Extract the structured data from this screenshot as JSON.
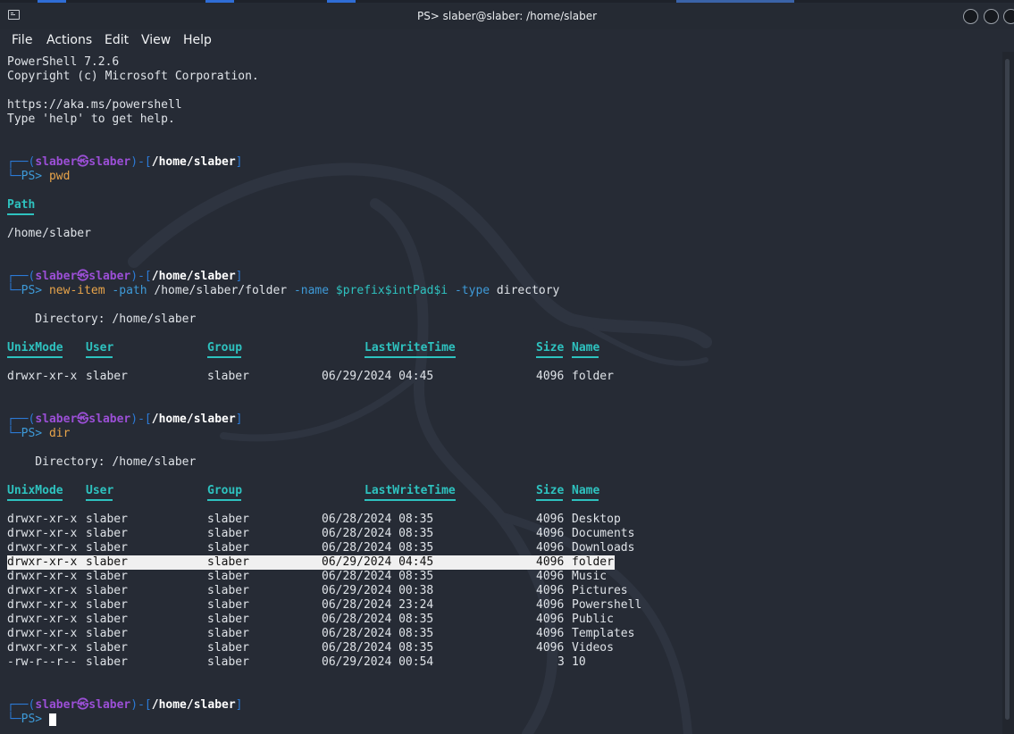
{
  "window": {
    "title": "PS> slaber@slaber: /home/slaber"
  },
  "menu": [
    "File",
    "Actions",
    "Edit",
    "View",
    "Help"
  ],
  "banner": [
    "PowerShell 7.2.6",
    "Copyright (c) Microsoft Corporation.",
    "",
    "https://aka.ms/powershell",
    "Type 'help' to get help."
  ],
  "prompt": {
    "user": "slaber",
    "symbol": "㉿",
    "host": "slaber",
    "dir": "/home/slaber",
    "ps": "PS>"
  },
  "cmd1": {
    "text": "pwd",
    "path_header": "Path",
    "path_value": "/home/slaber"
  },
  "cmd2": {
    "parts": [
      {
        "t": "new-item",
        "c": "cmd"
      },
      {
        "t": " ",
        "c": ""
      },
      {
        "t": "-path",
        "c": "prm"
      },
      {
        "t": " /home/slaber/folder ",
        "c": ""
      },
      {
        "t": "-name",
        "c": "prm"
      },
      {
        "t": " ",
        "c": ""
      },
      {
        "t": "$prefix$intPad$i",
        "c": "grnn"
      },
      {
        "t": " ",
        "c": ""
      },
      {
        "t": "-type",
        "c": "prm"
      },
      {
        "t": " directory",
        "c": ""
      }
    ],
    "directory_label": "    Directory: /home/slaber",
    "rows": [
      [
        "drwxr-xr-x",
        "slaber",
        "slaber",
        "06/29/2024 04:45",
        "4096",
        "folder"
      ]
    ]
  },
  "cmd3": {
    "text": "dir",
    "directory_label": "    Directory: /home/slaber",
    "selected_row": 3,
    "rows": [
      [
        "drwxr-xr-x",
        "slaber",
        "slaber",
        "06/28/2024 08:35",
        "4096",
        "Desktop"
      ],
      [
        "drwxr-xr-x",
        "slaber",
        "slaber",
        "06/28/2024 08:35",
        "4096",
        "Documents"
      ],
      [
        "drwxr-xr-x",
        "slaber",
        "slaber",
        "06/28/2024 08:35",
        "4096",
        "Downloads"
      ],
      [
        "drwxr-xr-x",
        "slaber",
        "slaber",
        "06/29/2024 04:45",
        "4096",
        "folder"
      ],
      [
        "drwxr-xr-x",
        "slaber",
        "slaber",
        "06/28/2024 08:35",
        "4096",
        "Music"
      ],
      [
        "drwxr-xr-x",
        "slaber",
        "slaber",
        "06/29/2024 00:38",
        "4096",
        "Pictures"
      ],
      [
        "drwxr-xr-x",
        "slaber",
        "slaber",
        "06/28/2024 23:24",
        "4096",
        "Powershell"
      ],
      [
        "drwxr-xr-x",
        "slaber",
        "slaber",
        "06/28/2024 08:35",
        "4096",
        "Public"
      ],
      [
        "drwxr-xr-x",
        "slaber",
        "slaber",
        "06/28/2024 08:35",
        "4096",
        "Templates"
      ],
      [
        "drwxr-xr-x",
        "slaber",
        "slaber",
        "06/28/2024 08:35",
        "4096",
        "Videos"
      ],
      [
        "-rw-r--r--",
        "slaber",
        "slaber",
        "06/29/2024 00:54",
        "3",
        "10"
      ]
    ]
  },
  "table_headers": [
    "UnixMode",
    "User",
    "Group",
    "LastWriteTime",
    "Size",
    "Name"
  ],
  "colors": {
    "background": "#262b35",
    "header": "#2ec2bf",
    "command": "#e8a44a",
    "param": "#3e9ad8",
    "user": "#9b4fd6",
    "frame": "#2c7ad6"
  }
}
